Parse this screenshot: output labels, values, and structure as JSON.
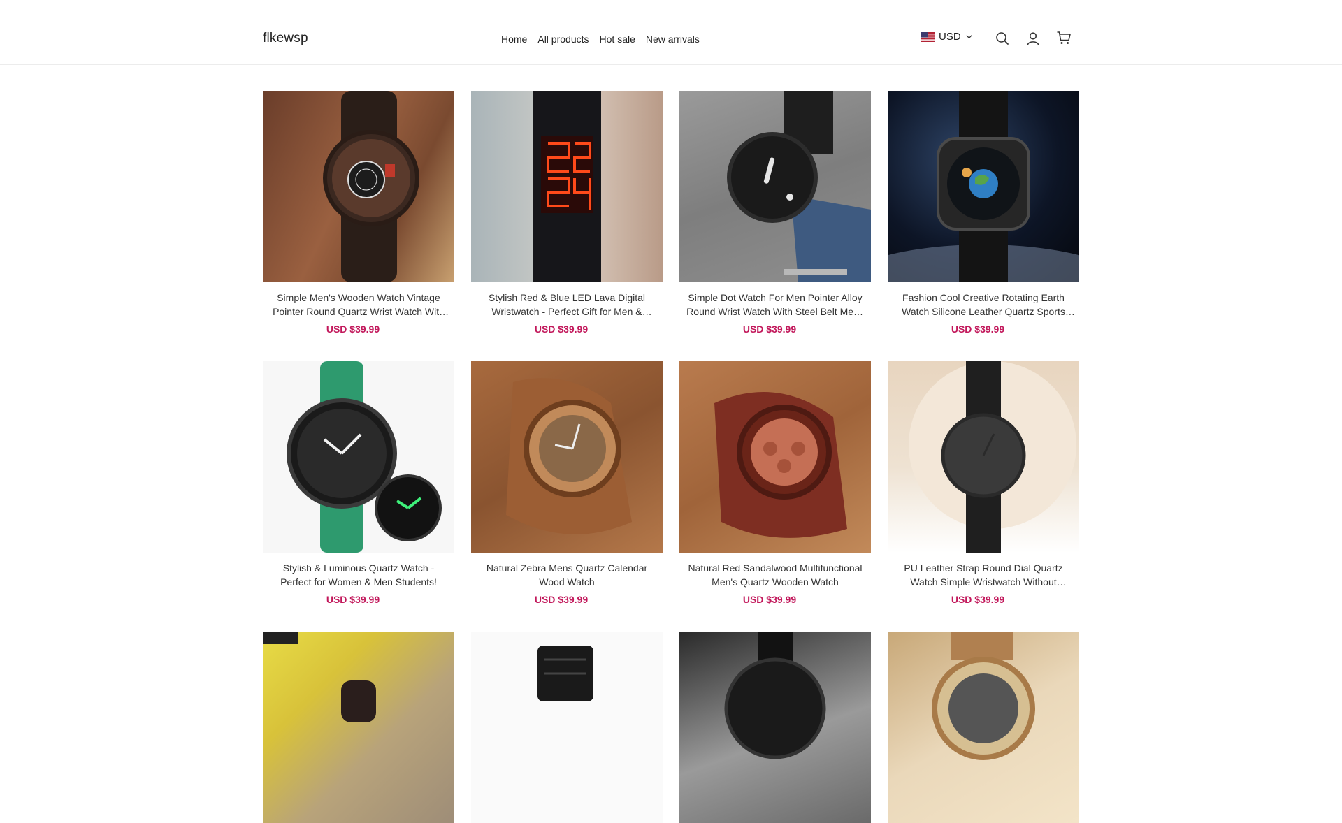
{
  "store": {
    "name": "flkewsp"
  },
  "nav": [
    {
      "label": "Home"
    },
    {
      "label": "All products"
    },
    {
      "label": "Hot sale"
    },
    {
      "label": "New arrivals"
    }
  ],
  "currency": {
    "label": "USD"
  },
  "icons": {
    "search": "search-icon",
    "account": "user-icon",
    "cart": "cart-icon",
    "flag": "us-flag-icon",
    "dropdown": "chevron-down-icon"
  },
  "colors": {
    "price": "#c2185b",
    "border": "#ececec"
  },
  "products": [
    {
      "title": "Simple Men's Wooden Watch Vintage Pointer Round Quartz Wrist Watch With Calendar",
      "price": "USD $39.99"
    },
    {
      "title": "Stylish Red & Blue LED Lava Digital Wristwatch - Perfect Gift for Men & Women!",
      "price": "USD $39.99"
    },
    {
      "title": "Simple Dot Watch For Men Pointer Alloy Round Wrist Watch With Steel Belt Mesh Strap",
      "price": "USD $39.99"
    },
    {
      "title": "Fashion Cool Creative Rotating Earth Watch Silicone Leather Quartz Sports Men Watch",
      "price": "USD $39.99"
    },
    {
      "title": "Stylish & Luminous Quartz Watch - Perfect for Women & Men Students!",
      "price": "USD $39.99"
    },
    {
      "title": "Natural Zebra Mens Quartz Calendar Wood Watch",
      "price": "USD $39.99"
    },
    {
      "title": "Natural Red Sandalwood Multifunctional Men's Quartz Wooden Watch",
      "price": "USD $39.99"
    },
    {
      "title": "PU Leather Strap Round Dial Quartz Watch Simple Wristwatch Without Second Hand",
      "price": "USD $39.99"
    },
    {
      "title": "",
      "price": ""
    },
    {
      "title": "",
      "price": ""
    },
    {
      "title": "",
      "price": ""
    },
    {
      "title": "",
      "price": ""
    }
  ]
}
